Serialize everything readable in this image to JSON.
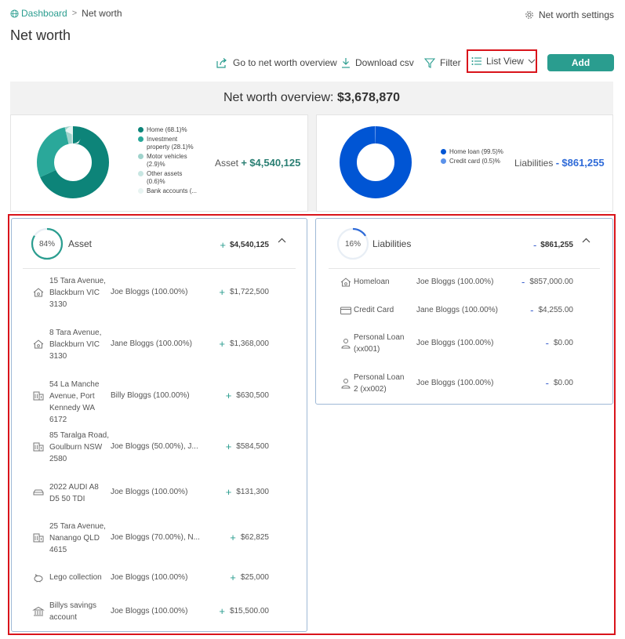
{
  "breadcrumb": {
    "home": "Dashboard",
    "separator": ">",
    "current": "Net worth"
  },
  "settings_link": "Net worth settings",
  "page_title": "Net worth",
  "toolbar": {
    "overview": "Go to net worth overview",
    "download": "Download csv",
    "filter": "Filter",
    "view": "List View",
    "add": "Add"
  },
  "overview": {
    "label": "Net worth overview:",
    "amount": "$3,678,870",
    "asset": {
      "label": "Asset",
      "sign": "+",
      "amount": "$4,540,125",
      "color": "#2a7f73",
      "legend": [
        {
          "label": "Home (68.1)%",
          "value": 68.1,
          "color": "#0d8479"
        },
        {
          "label": "Investment property (28.1)%",
          "value": 28.1,
          "color": "#2aa89a"
        },
        {
          "label": "Motor vehicles (2.9)%",
          "value": 2.9,
          "color": "#9fd3cc"
        },
        {
          "label": "Other assets (0.6)%",
          "value": 0.6,
          "color": "#c8e6e2"
        },
        {
          "label": "Bank accounts (...",
          "value": 0.3,
          "color": "#e8f4f2"
        }
      ]
    },
    "liabilities": {
      "label": "Liabilities",
      "sign": "-",
      "amount": "$861,255",
      "color": "#2f6bd8",
      "legend": [
        {
          "label": "Home loan (99.5)%",
          "value": 99.5,
          "color": "#0055d4"
        },
        {
          "label": "Credit card (0.5)%",
          "value": 0.5,
          "color": "#5b92ea"
        }
      ]
    }
  },
  "asset_panel": {
    "percent": 84,
    "percent_label": "84%",
    "title": "Asset",
    "sign": "+",
    "total": "$4,540,125",
    "ring_color": "#2a9d8f",
    "rows": [
      {
        "icon": "house-icon",
        "name": "15 Tara Avenue, Blackburn VIC 3130",
        "owner": "Joe Bloggs (100.00%)",
        "sign": "+",
        "amount": "$1,722,500"
      },
      {
        "icon": "house-icon",
        "name": "8 Tara Avenue, Blackburn VIC 3130",
        "owner": "Jane Bloggs (100.00%)",
        "sign": "+",
        "amount": "$1,368,000"
      },
      {
        "icon": "building-icon",
        "name": "54 La Manche Avenue, Port Kennedy WA 6172",
        "owner": "Billy Bloggs (100.00%)",
        "sign": "+",
        "amount": "$630,500"
      },
      {
        "icon": "building-icon",
        "name": "85 Taralga Road, Goulburn NSW 2580",
        "owner": "Joe Bloggs (50.00%), J...",
        "sign": "+",
        "amount": "$584,500"
      },
      {
        "icon": "car-icon",
        "name": "2022 AUDI A8 D5 50 TDI",
        "owner": "Joe Bloggs (100.00%)",
        "sign": "+",
        "amount": "$131,300"
      },
      {
        "icon": "building-icon",
        "name": "25 Tara Avenue, Nanango QLD 4615",
        "owner": "Joe Bloggs (70.00%), N...",
        "sign": "+",
        "amount": "$62,825"
      },
      {
        "icon": "piggy-bank-icon",
        "name": "Lego collection",
        "owner": "Joe Bloggs (100.00%)",
        "sign": "+",
        "amount": "$25,000"
      },
      {
        "icon": "bank-icon",
        "name": "Billys savings account",
        "owner": "Joe Bloggs (100.00%)",
        "sign": "+",
        "amount": "$15,500.00"
      }
    ]
  },
  "liabilities_panel": {
    "percent": 16,
    "percent_label": "16%",
    "title": "Liabilities",
    "sign": "-",
    "total": "$861,255",
    "ring_color": "#2f6bd8",
    "rows": [
      {
        "icon": "house-icon",
        "name": "Homeloan",
        "owner": "Joe Bloggs (100.00%)",
        "sign": "-",
        "amount": "$857,000.00"
      },
      {
        "icon": "credit-card-icon",
        "name": "Credit Card",
        "owner": "Jane Bloggs (100.00%)",
        "sign": "-",
        "amount": "$4,255.00"
      },
      {
        "icon": "person-icon",
        "name": "Personal Loan (xx001)",
        "owner": "Joe Bloggs (100.00%)",
        "sign": "-",
        "amount": "$0.00"
      },
      {
        "icon": "person-icon",
        "name": "Personal Loan 2 (xx002)",
        "owner": "Joe Bloggs (100.00%)",
        "sign": "-",
        "amount": "$0.00"
      }
    ]
  }
}
